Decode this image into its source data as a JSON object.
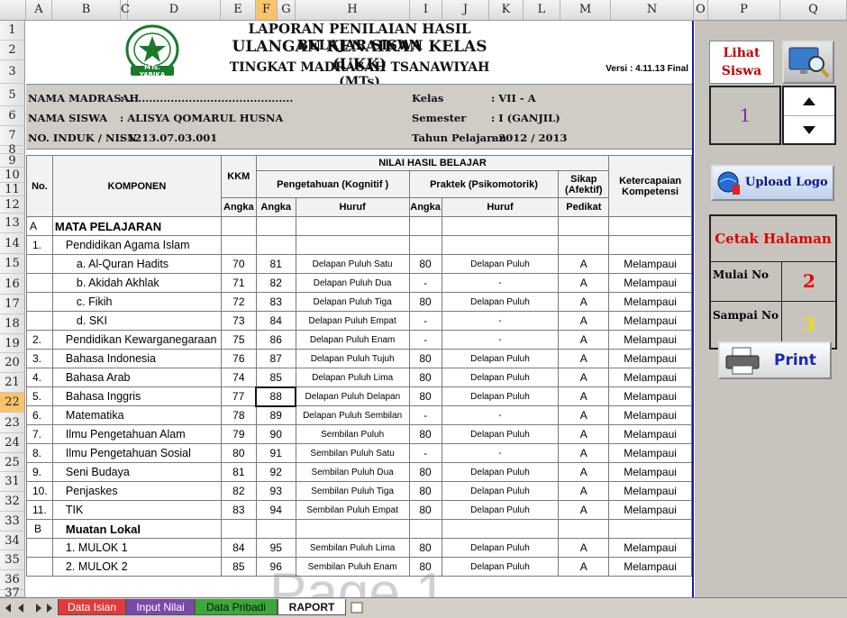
{
  "columns": [
    "A",
    "B",
    "C",
    "D",
    "E",
    "F",
    "G",
    "H",
    "I",
    "J",
    "K",
    "L",
    "M",
    "N",
    "O",
    "P",
    "Q"
  ],
  "row_numbers": [
    "1",
    "2",
    "3",
    "5",
    "6",
    "7",
    "8",
    "9",
    "10",
    "11",
    "12",
    "13",
    "14",
    "15",
    "16",
    "17",
    "18",
    "19",
    "20",
    "21",
    "22",
    "23",
    "24",
    "25",
    "31",
    "32",
    "33",
    "34",
    "35",
    "36",
    "37"
  ],
  "selected_row": "22",
  "title": {
    "line1": "LAPORAN PENILAIAN HASIL BELAJAR SISWA",
    "line2": "ULANGAN KENAIKAN KELAS (UKK)",
    "line3": "TINGKAT MADRASAH TSANAWIYAH (MTs)",
    "versi": "Versi : 4.11.13 Final",
    "logo_text": "MTs. YABIKA"
  },
  "info": {
    "nama_madrasah_label": "NAMA MADRASAH",
    "nama_madrasah_value": ": ..............................................",
    "nama_siswa_label": "NAMA SISWA",
    "nama_siswa_value": ": ALISYA QOMARUL HUSNA",
    "no_induk_label": "NO. INDUK / NISN",
    "no_induk_value": ": 1213.07.03.001",
    "kelas_label": "Kelas",
    "kelas_value": ": VII - A",
    "semester_label": "Semester",
    "semester_value": ": I (GANJIL)",
    "tahun_label": "Tahun Pelajaran",
    "tahun_value": ": 2012 / 2013"
  },
  "table_headers": {
    "no": "No.",
    "komponen": "KOMPONEN",
    "kkm": "KKM",
    "nilai": "NILAI HASIL BELAJAR",
    "pengetahuan": "Pengetahuan (Kognitif )",
    "praktek": "Praktek (Psikomotorik)",
    "sikap": "Sikap (Afektif)",
    "ketercapaian": "Ketercapaian Kompetensi",
    "angka": "Angka",
    "huruf": "Huruf",
    "pedikat": "Pedikat"
  },
  "sections": {
    "a_letter": "A",
    "a_title": "MATA PELAJARAN",
    "b_letter": "B",
    "b_title": "Muatan Lokal"
  },
  "rows": [
    {
      "no": "1.",
      "name": "Pendidikan Agama Islam",
      "kkm": "",
      "ang": "",
      "huruf": "",
      "pang": "",
      "phuruf": "",
      "sikap": "",
      "ket": ""
    },
    {
      "no": "",
      "name": "a. Al-Quran Hadits",
      "kkm": "70",
      "ang": "81",
      "huruf": "Delapan Puluh Satu",
      "pang": "80",
      "phuruf": "Delapan Puluh",
      "sikap": "A",
      "ket": "Melampaui"
    },
    {
      "no": "",
      "name": "b. Akidah Akhlak",
      "kkm": "71",
      "ang": "82",
      "huruf": "Delapan Puluh Dua",
      "pang": "-",
      "phuruf": "-",
      "sikap": "A",
      "ket": "Melampaui"
    },
    {
      "no": "",
      "name": "c. Fikih",
      "kkm": "72",
      "ang": "83",
      "huruf": "Delapan Puluh Tiga",
      "pang": "80",
      "phuruf": "Delapan Puluh",
      "sikap": "A",
      "ket": "Melampaui"
    },
    {
      "no": "",
      "name": "d. SKI",
      "kkm": "73",
      "ang": "84",
      "huruf": "Delapan Puluh Empat",
      "pang": "-",
      "phuruf": "-",
      "sikap": "A",
      "ket": "Melampaui"
    },
    {
      "no": "2.",
      "name": "Pendidikan Kewarganegaraan",
      "kkm": "75",
      "ang": "86",
      "huruf": "Delapan Puluh Enam",
      "pang": "-",
      "phuruf": "-",
      "sikap": "A",
      "ket": "Melampaui"
    },
    {
      "no": "3.",
      "name": "Bahasa Indonesia",
      "kkm": "76",
      "ang": "87",
      "huruf": "Delapan Puluh Tujuh",
      "pang": "80",
      "phuruf": "Delapan Puluh",
      "sikap": "A",
      "ket": "Melampaui"
    },
    {
      "no": "4.",
      "name": "Bahasa Arab",
      "kkm": "74",
      "ang": "85",
      "huruf": "Delapan Puluh Lima",
      "pang": "80",
      "phuruf": "Delapan Puluh",
      "sikap": "A",
      "ket": "Melampaui"
    },
    {
      "no": "5.",
      "name": "Bahasa Inggris",
      "kkm": "77",
      "ang": "88",
      "huruf": "Delapan Puluh Delapan",
      "pang": "80",
      "phuruf": "Delapan Puluh",
      "sikap": "A",
      "ket": "Melampaui"
    },
    {
      "no": "6.",
      "name": "Matematika",
      "kkm": "78",
      "ang": "89",
      "huruf": "Delapan Puluh Sembilan",
      "pang": "-",
      "phuruf": "-",
      "sikap": "A",
      "ket": "Melampaui"
    },
    {
      "no": "7.",
      "name": "Ilmu Pengetahuan Alam",
      "kkm": "79",
      "ang": "90",
      "huruf": "Sembilan Puluh",
      "pang": "80",
      "phuruf": "Delapan Puluh",
      "sikap": "A",
      "ket": "Melampaui"
    },
    {
      "no": "8.",
      "name": "Ilmu Pengetahuan Sosial",
      "kkm": "80",
      "ang": "91",
      "huruf": "Sembilan Puluh Satu",
      "pang": "-",
      "phuruf": "-",
      "sikap": "A",
      "ket": "Melampaui"
    },
    {
      "no": "9.",
      "name": "Seni Budaya",
      "kkm": "81",
      "ang": "92",
      "huruf": "Sembilan Puluh Dua",
      "pang": "80",
      "phuruf": "Delapan Puluh",
      "sikap": "A",
      "ket": "Melampaui"
    },
    {
      "no": "10.",
      "name": "Penjaskes",
      "kkm": "82",
      "ang": "93",
      "huruf": "Sembilan Puluh Tiga",
      "pang": "80",
      "phuruf": "Delapan Puluh",
      "sikap": "A",
      "ket": "Melampaui"
    },
    {
      "no": "11.",
      "name": "TIK",
      "kkm": "83",
      "ang": "94",
      "huruf": "Sembilan Puluh Empat",
      "pang": "80",
      "phuruf": "Delapan Puluh",
      "sikap": "A",
      "ket": "Melampaui"
    }
  ],
  "mulok_rows": [
    {
      "no": "",
      "name": "1. MULOK 1",
      "kkm": "84",
      "ang": "95",
      "huruf": "Sembilan Puluh Lima",
      "pang": "80",
      "phuruf": "Delapan Puluh",
      "sikap": "A",
      "ket": "Melampaui"
    },
    {
      "no": "",
      "name": "2. MULOK 2",
      "kkm": "85",
      "ang": "96",
      "huruf": "Sembilan Puluh Enam",
      "pang": "80",
      "phuruf": "Delapan Puluh",
      "sikap": "A",
      "ket": "Melampaui"
    }
  ],
  "watermark": "Page 1",
  "panel": {
    "lihat_siswa": "Lihat Siswa",
    "student_number": "1",
    "upload_logo": "Upload Logo",
    "cetak_halaman": "Cetak Halaman",
    "mulai_label": "Mulai No",
    "mulai_value": "2",
    "sampai_label": "Sampai No",
    "sampai_value": "3",
    "print": "Print"
  },
  "sheet_tabs": [
    "Data Isian",
    "Input Nilai",
    "Data Pribadi",
    "RAPORT"
  ],
  "active_tab": "RAPORT"
}
